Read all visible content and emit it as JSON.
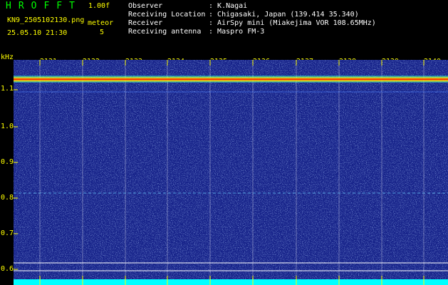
{
  "header": {
    "app_name": "HROFFT",
    "version": "1.00f",
    "filename": "KN9_2505102130.png",
    "shower_label": "meteor",
    "datetime": "25.05.10 21:30",
    "count": "5",
    "meta": [
      {
        "key": "Observer",
        "value": "K.Nagai"
      },
      {
        "key": "Receiving Location",
        "value": "Chigasaki, Japan (139.414 35.340)"
      },
      {
        "key": "Receiver",
        "value": "AirSpy mini (Miakejima VOR 108.65MHz)"
      },
      {
        "key": "Receiving antenna",
        "value": "Maspro FM-3"
      }
    ]
  },
  "axis": {
    "unit": "kHz",
    "y_ticks": [
      "1.1",
      "1.0",
      "0.9",
      "0.8",
      "0.7",
      "0.6"
    ],
    "x_ticks": [
      "2131",
      "2132",
      "2133",
      "2134",
      "2135",
      "2136",
      "2137",
      "2138",
      "2139",
      "2140"
    ]
  },
  "colors": {
    "background": "#1a2a8a",
    "label": "#ffff00",
    "carrier": "#ff3300",
    "floor": "#00ffff"
  }
}
